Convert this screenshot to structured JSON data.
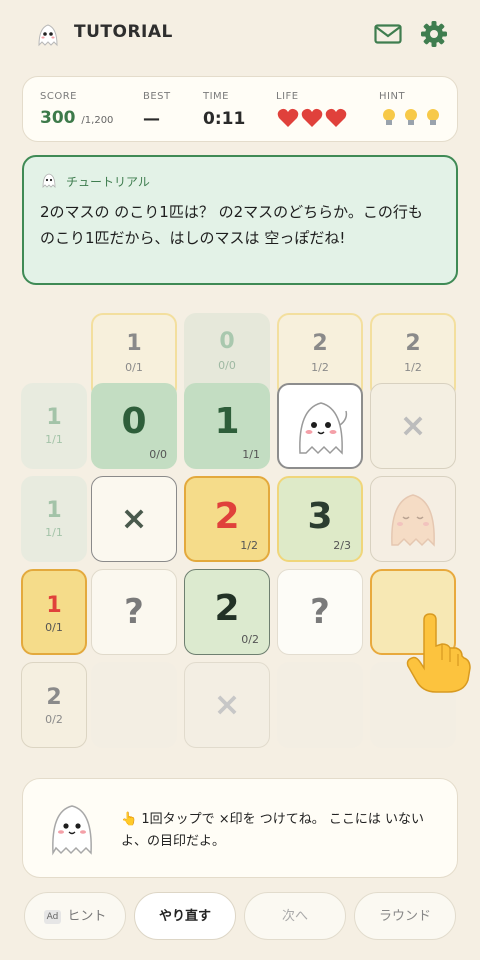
{
  "header": {
    "title": "TUTORIAL"
  },
  "stats": {
    "score_label": "SCORE",
    "score": "300",
    "score_max": "/1,200",
    "best_label": "BEST",
    "best": "—",
    "time_label": "TIME",
    "time": "0:11",
    "life_label": "LIFE",
    "lives": 3,
    "hint_label": "HINT",
    "hints": 3
  },
  "tutorial": {
    "label": "チュートリアル",
    "text": "2のマスの のこり1匹は？ の2マスのどちらか。この行も のこり1匹だから、はしのマスは 空っぽだね!"
  },
  "columns": [
    {
      "n": "1",
      "f": "0/1"
    },
    {
      "n": "0",
      "f": "0/0"
    },
    {
      "n": "2",
      "f": "1/2"
    },
    {
      "n": "2",
      "f": "1/2"
    }
  ],
  "rows": [
    {
      "n": "1",
      "f": "1/1"
    },
    {
      "n": "1",
      "f": "1/1"
    },
    {
      "n": "1",
      "f": "0/1"
    },
    {
      "n": "2",
      "f": "0/2"
    }
  ],
  "cells": {
    "r1c1": {
      "n": "0",
      "sub": "0/0"
    },
    "r1c2": {
      "n": "1",
      "sub": "1/1"
    },
    "r1c4": {
      "mark": "×"
    },
    "r2c1": {
      "mark": "×"
    },
    "r2c2": {
      "n": "2",
      "sub": "1/2"
    },
    "r2c3": {
      "n": "3",
      "sub": "2/3"
    },
    "r3c1": {
      "mark": "?"
    },
    "r3c2": {
      "n": "2",
      "sub": "0/2"
    },
    "r3c3": {
      "mark": "?"
    },
    "r4c2": {
      "mark": "×"
    }
  },
  "hint_box": {
    "pointer": "👆",
    "text": "1回タップで ×印を つけてね。 ここには いないよ、の目印だよ。"
  },
  "buttons": {
    "ad": "Ad",
    "hint": "ヒント",
    "redo": "やり直す",
    "next": "次へ",
    "round": "ラウンド"
  },
  "colors": {
    "accent": "#3f8a55",
    "highlight": "#f5dc8a",
    "danger": "#e0413b"
  }
}
